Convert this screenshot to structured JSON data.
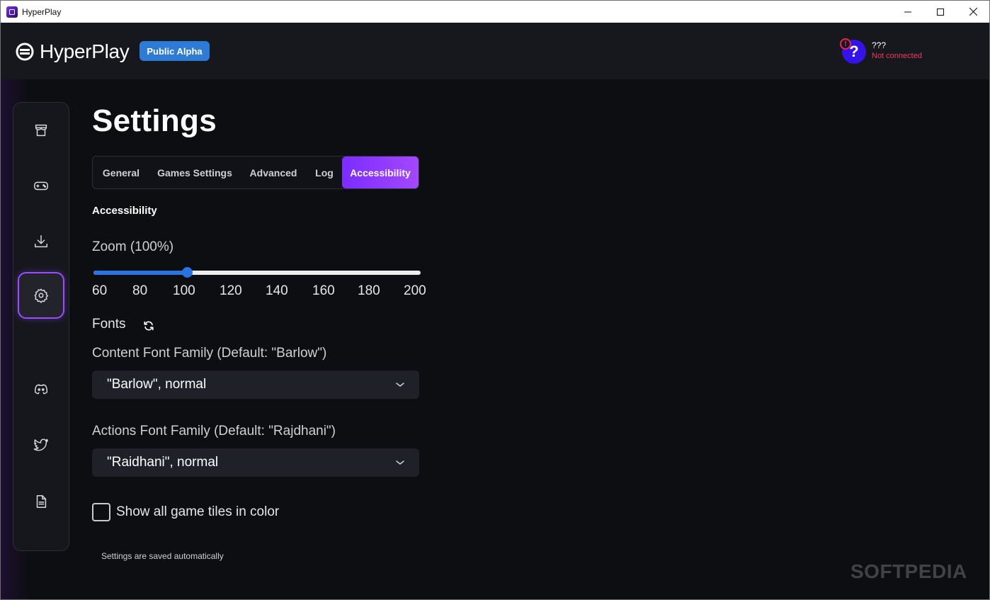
{
  "window": {
    "title": "HyperPlay"
  },
  "header": {
    "logo_text": "HyperPlay",
    "badge": "Public Alpha",
    "wallet": {
      "name": "???",
      "status": "Not connected",
      "alert_symbol": "!",
      "avatar_symbol": "?"
    }
  },
  "sidebar": {
    "items": [
      {
        "icon": "store-icon"
      },
      {
        "icon": "gamepad-icon"
      },
      {
        "icon": "download-icon"
      },
      {
        "icon": "settings-icon",
        "active": true
      },
      {
        "icon": "discord-icon"
      },
      {
        "icon": "twitter-icon"
      },
      {
        "icon": "document-icon"
      }
    ]
  },
  "main": {
    "title": "Settings",
    "tabs": [
      {
        "label": "General"
      },
      {
        "label": "Games Settings"
      },
      {
        "label": "Advanced"
      },
      {
        "label": "Log"
      },
      {
        "label": "Accessibility",
        "active": true
      }
    ],
    "section_title": "Accessibility",
    "zoom": {
      "label": "Zoom (100%)",
      "min": 60,
      "max": 200,
      "value": 100,
      "ticks": [
        "60",
        "80",
        "100",
        "120",
        "140",
        "160",
        "180",
        "200"
      ]
    },
    "fonts": {
      "label": "Fonts",
      "content_label": "Content Font Family (Default: \"Barlow\")",
      "content_value": "\"Barlow\", normal",
      "actions_label": "Actions Font Family (Default: \"Rajdhani\")",
      "actions_value": "\"Raidhani\", normal"
    },
    "color_tiles_label": "Show all game tiles in color",
    "color_tiles_checked": false,
    "footer_note": "Settings are saved automatically"
  },
  "watermark": "SOFTPEDIA",
  "colors": {
    "accent": "#9b4dff",
    "slider": "#2a73e0",
    "badge": "#2e7bd6",
    "error": "#f0395e"
  }
}
